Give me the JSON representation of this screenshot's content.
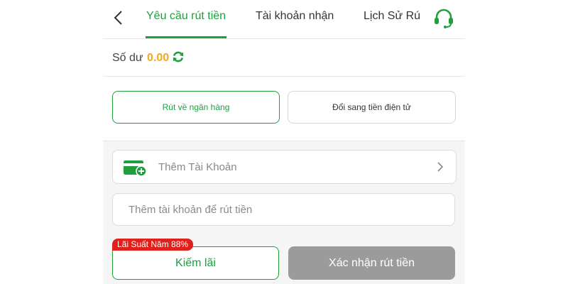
{
  "header": {
    "tabs": [
      {
        "label": "Yêu cầu rút tiền",
        "active": true
      },
      {
        "label": "Tài khoản nhận",
        "active": false
      },
      {
        "label": "Lịch Sử Rú",
        "active": false
      }
    ],
    "back_icon": "chevron-left-icon",
    "support_icon": "headset-icon"
  },
  "balance": {
    "label": "Số dư",
    "value": "0.00",
    "refresh_icon": "refresh-icon"
  },
  "methods": {
    "bank_label": "Rút về ngân hàng",
    "ewallet_label": "Đổi sang tiền điện tử"
  },
  "form": {
    "add_account_label": "Thêm Tài Khoản",
    "add_account_icon": "wallet-add-icon",
    "account_placeholder": "Thêm tài khoản để rút tiền",
    "account_value": ""
  },
  "actions": {
    "rate_badge": "Lãi Suất Năm 88%",
    "earn_label": "Kiếm lãi",
    "confirm_label": "Xác nhận rút tiền"
  },
  "colors": {
    "accent": "#1f9e3e",
    "balance": "#f5a623",
    "badge": "#e0201a",
    "disabled_button": "#9b9b9b"
  }
}
